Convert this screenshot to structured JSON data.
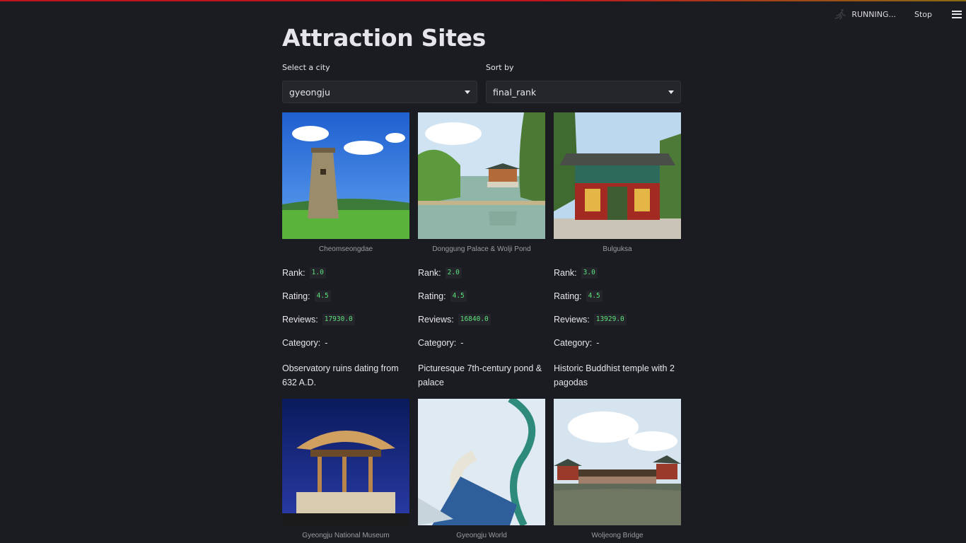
{
  "status": {
    "running_label": "RUNNING...",
    "stop_label": "Stop"
  },
  "page": {
    "title": "Attraction Sites"
  },
  "filters": {
    "city": {
      "label": "Select a city",
      "value": "gyeongju"
    },
    "sort": {
      "label": "Sort by",
      "value": "final_rank"
    }
  },
  "labels": {
    "rank": "Rank:",
    "rating": "Rating:",
    "reviews": "Reviews:",
    "category": "Category:"
  },
  "sites": [
    {
      "name": "Cheomseongdae",
      "rank": "1.0",
      "rating": "4.5",
      "reviews": "17930.0",
      "category": "-",
      "description": "Observatory ruins dating from 632 A.D."
    },
    {
      "name": "Donggung Palace & Wolji Pond",
      "rank": "2.0",
      "rating": "4.5",
      "reviews": "16840.0",
      "category": "-",
      "description": "Picturesque 7th-century pond & palace"
    },
    {
      "name": "Bulguksa",
      "rank": "3.0",
      "rating": "4.5",
      "reviews": "13929.0",
      "category": "-",
      "description": "Historic Buddhist temple with 2 pagodas"
    },
    {
      "name": "Gyeongju National Museum"
    },
    {
      "name": "Gyeongju World"
    },
    {
      "name": "Woljeong Bridge"
    }
  ],
  "icons": {
    "status": "running-figure-icon",
    "menu": "hamburger-menu-icon",
    "dropdown": "chevron-down-icon"
  }
}
